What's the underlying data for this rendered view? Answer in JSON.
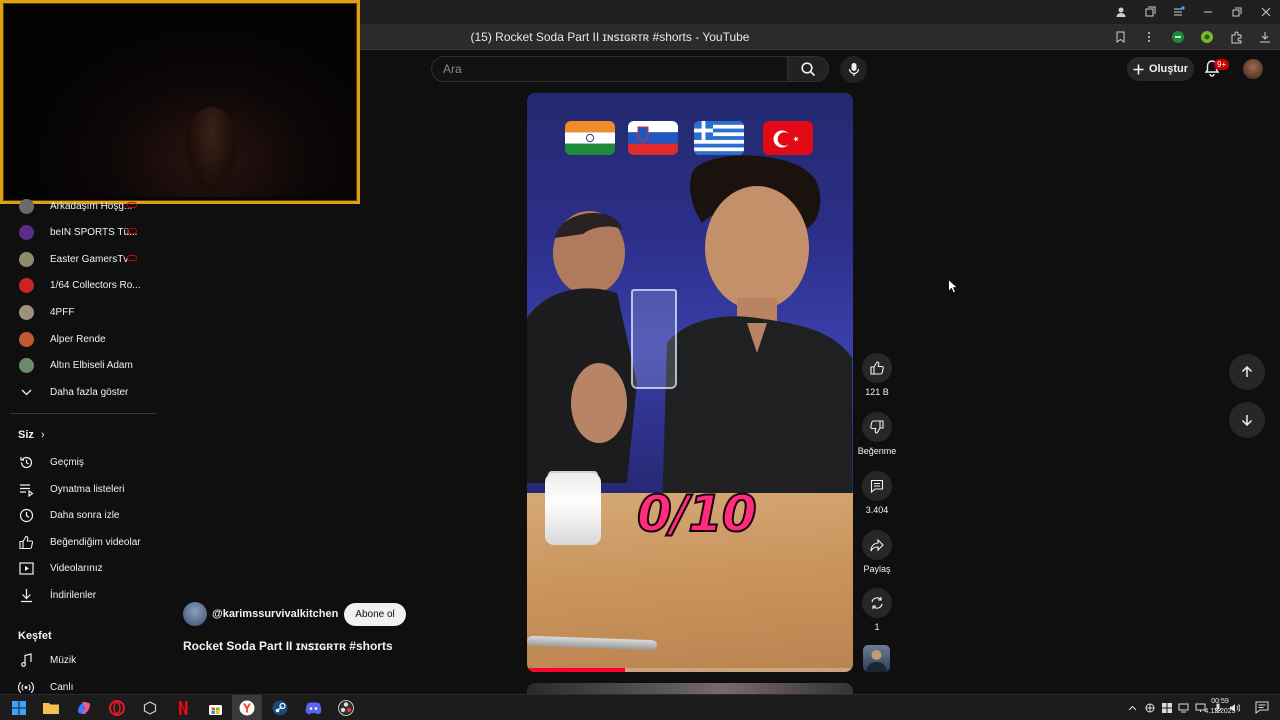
{
  "browser": {
    "tab_title": "(15) Rocket Soda Part II ɪɴꜱɪɢʀᴛʀ #shorts - YouTube"
  },
  "header": {
    "search_placeholder": "Ara",
    "create_label": "Oluştur",
    "notification_badge": "9+"
  },
  "sidebar": {
    "subscriptions": [
      {
        "label": "Arkadaşım Hoşg...",
        "live": true,
        "avatar_color": "#6b6b6b"
      },
      {
        "label": "beIN SPORTS Tü...",
        "live": true,
        "avatar_color": "#5b2d8a"
      },
      {
        "label": "Easter GamersTv",
        "live": true,
        "avatar_color": "#8c8c6a"
      },
      {
        "label": "1/64 Collectors Ro...",
        "live": false,
        "avatar_color": "#cc2222"
      },
      {
        "label": "4PFF",
        "live": false,
        "avatar_color": "#a09080"
      },
      {
        "label": "Alper Rende",
        "live": false,
        "avatar_color": "#c05a30"
      },
      {
        "label": "Altın Elbiseli Adam",
        "live": false,
        "avatar_color": "#6a8a6a"
      }
    ],
    "show_more": "Daha fazla göster",
    "you_section": "Siz",
    "you_items": [
      {
        "label": "Geçmiş",
        "icon": "history-icon"
      },
      {
        "label": "Oynatma listeleri",
        "icon": "playlists-icon"
      },
      {
        "label": "Daha sonra izle",
        "icon": "watch-later-icon"
      },
      {
        "label": "Beğendiğim videolar",
        "icon": "liked-icon"
      },
      {
        "label": "Videolarınız",
        "icon": "your-videos-icon"
      },
      {
        "label": "İndirilenler",
        "icon": "downloads-icon"
      }
    ],
    "explore_section": "Keşfet",
    "explore_items": [
      {
        "label": "Müzik",
        "icon": "music-icon"
      },
      {
        "label": "Canlı",
        "icon": "live-icon"
      }
    ]
  },
  "short": {
    "overlay_score": "0/10",
    "progress": 0.3,
    "channel_handle": "@karimssurvivalkitchen",
    "subscribe_label": "Abone ol",
    "title": "Rocket Soda Part II ɪɴꜱɪɢʀᴛʀ #shorts",
    "flags": [
      "india",
      "slovenia",
      "greece",
      "turkey"
    ]
  },
  "actions": {
    "like_count": "121 B",
    "dislike_label": "Beğenme",
    "comment_count": "3.404",
    "share_label": "Paylaş",
    "remix_count": "1"
  },
  "taskbar": {
    "time": "00:59",
    "date": "4.12.2025"
  }
}
